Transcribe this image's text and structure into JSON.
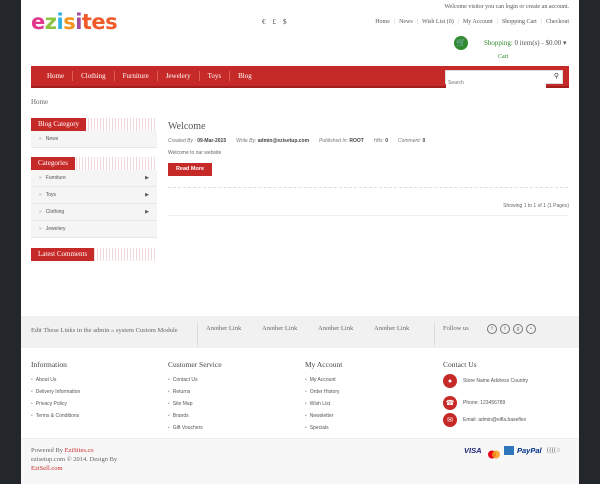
{
  "header": {
    "logo_text": "ezisites",
    "currencies": [
      "€",
      "£",
      "$"
    ],
    "welcome_prefix": "Welcome visitor you can",
    "login": "login",
    "or": "or",
    "create_account": "create an account",
    "top_links": [
      "Home",
      "News",
      "Wish List (0)",
      "My Account",
      "Shopping Cart",
      "Checkout"
    ],
    "shopping_label": "Shopping:",
    "cart_summary": "0 item(s) - $0.00",
    "cart_label": "Cart"
  },
  "nav": {
    "items": [
      "Home",
      "Clothing",
      "Furniture",
      "Jewelery",
      "Toys",
      "Blog"
    ],
    "search_placeholder": "Search"
  },
  "breadcrumb": "Home",
  "sidebar": {
    "blog_category": {
      "title": "Blog Category",
      "items": [
        "News"
      ]
    },
    "categories": {
      "title": "Categories",
      "items": [
        "Furniture",
        "Toys",
        "Clothing",
        "Jewelery"
      ]
    },
    "latest_comments": {
      "title": "Latest Comments"
    }
  },
  "article": {
    "title": "Welcome",
    "created_label": "Created By :",
    "created_value": "09-Mar-2015",
    "write_label": "Write By:",
    "write_value": "admin@ezisetup.com",
    "published_label": "Published In:",
    "published_value": "ROOT",
    "hits_label": "Hits:",
    "hits_value": "0",
    "comment_label": "Comment:",
    "comment_value": "0",
    "body": "Welcome to our website",
    "read_more": "Read More"
  },
  "pagination_text": "Showing 1 to 1 of 1 (1 Pages)",
  "footer_band": {
    "edit_text": "Edit These Links in the admin » system Custom Module",
    "links": [
      "Another Link",
      "Another Link",
      "Another Link",
      "Another Link"
    ],
    "follow": "Follow us"
  },
  "footer": {
    "information": {
      "title": "Information",
      "items": [
        "About Us",
        "Delivery Information",
        "Privacy Policy",
        "Terms & Conditions"
      ]
    },
    "customer_service": {
      "title": "Customer Service",
      "items": [
        "Contact Us",
        "Returns",
        "Site Map",
        "Brands",
        "Gift Vouchers"
      ]
    },
    "my_account": {
      "title": "My Account",
      "items": [
        "My Account",
        "Order History",
        "Wish List",
        "Newsletter",
        "Specials"
      ]
    },
    "contact": {
      "title": "Contact Us",
      "address": "Store Name Address Country",
      "phone": "Phone: 123456789",
      "email": "Email: admin@eifla.baseflex"
    }
  },
  "bottom": {
    "powered_prefix": "Powered By",
    "powered_brand": "EziSites.co",
    "copyright": "ezisetup.com © 2014. Design By",
    "designer": "EziSell.com",
    "payments": [
      "VISA",
      "PayPal"
    ]
  },
  "colors": {
    "accent": "#c62a28",
    "green": "#2e8b2e",
    "background": "#23262a"
  }
}
